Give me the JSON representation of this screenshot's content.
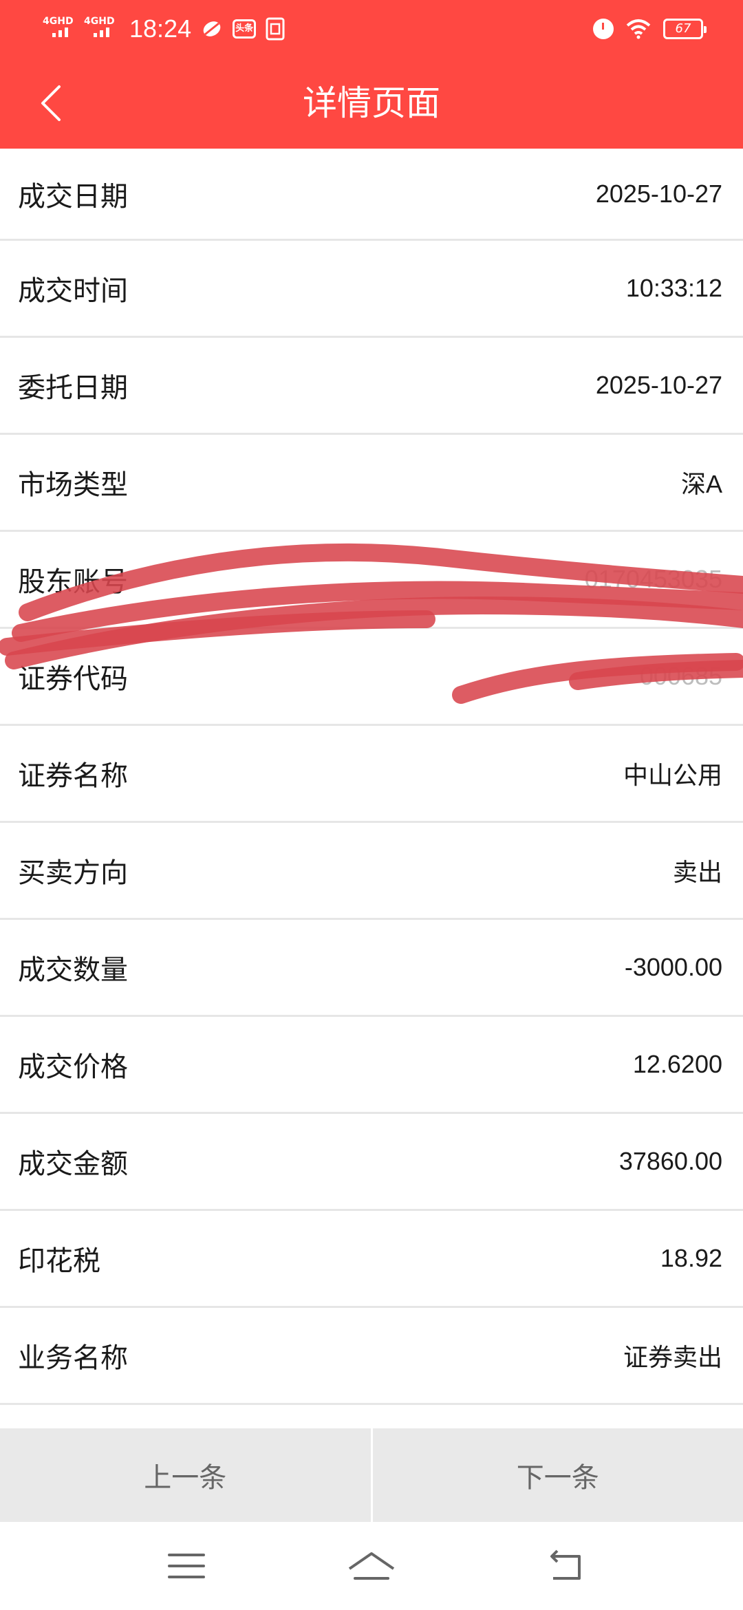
{
  "status_bar": {
    "network_1": "4GHD",
    "network_2": "4GHD",
    "time": "18:24",
    "toutiao_icon_text": "头条",
    "battery_level": "67"
  },
  "header": {
    "title": "详情页面"
  },
  "details": [
    {
      "label": "成交日期",
      "value": "2025-10-27"
    },
    {
      "label": "成交时间",
      "value": "10:33:12"
    },
    {
      "label": "委托日期",
      "value": "2025-10-27"
    },
    {
      "label": "市场类型",
      "value": "深A"
    },
    {
      "label": "股东账号",
      "value": "0170453035"
    },
    {
      "label": "证券代码",
      "value": "000685"
    },
    {
      "label": "证券名称",
      "value": "中山公用"
    },
    {
      "label": "买卖方向",
      "value": "卖出"
    },
    {
      "label": "成交数量",
      "value": "-3000.00"
    },
    {
      "label": "成交价格",
      "value": "12.6200"
    },
    {
      "label": "成交金额",
      "value": "37860.00"
    },
    {
      "label": "印花税",
      "value": "18.92"
    },
    {
      "label": "业务名称",
      "value": "证券卖出"
    }
  ],
  "footer": {
    "prev_label": "上一条",
    "next_label": "下一条"
  },
  "colors": {
    "header_bg": "#ff4842",
    "scribble": "#d8454d",
    "footer_bg": "#e9e9e9"
  }
}
